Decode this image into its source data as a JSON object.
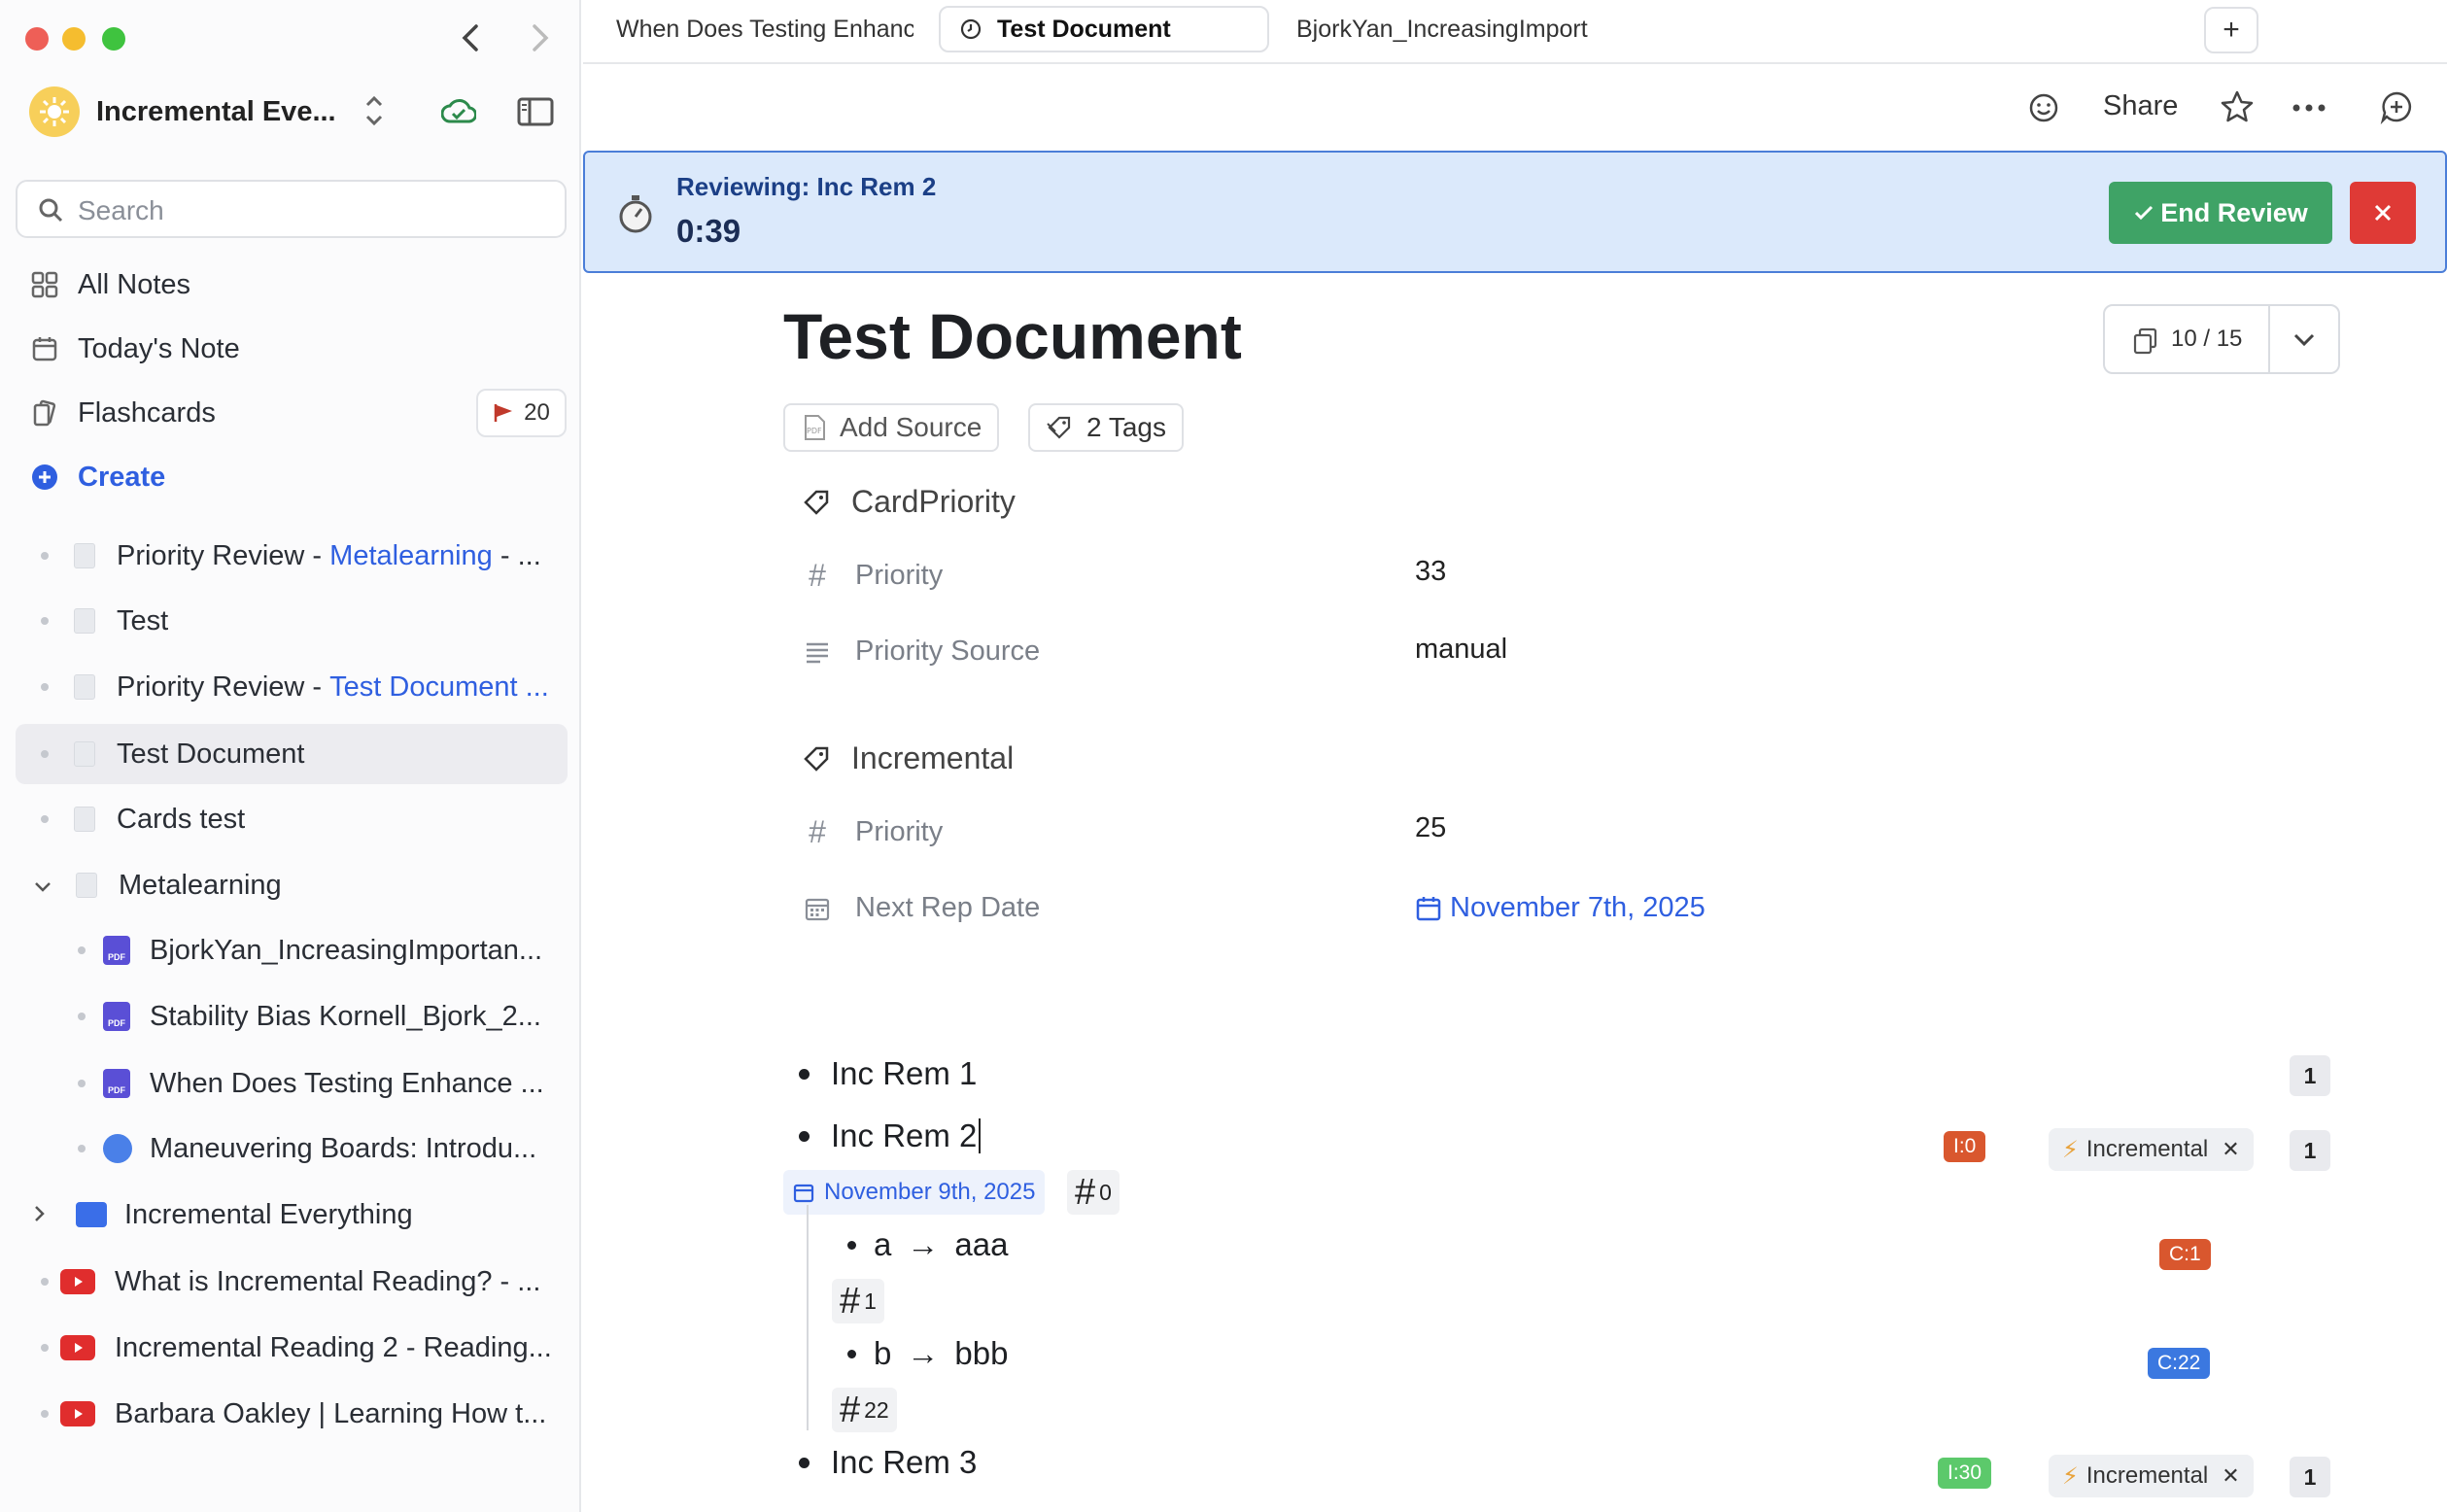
{
  "sidebar": {
    "workspace_name": "Incremental Eve...",
    "search_placeholder": "Search",
    "nav": {
      "all_notes": "All Notes",
      "todays_note": "Today's Note",
      "flashcards": "Flashcards",
      "flashcards_count": "20",
      "create": "Create"
    },
    "tree": {
      "r1_a": "Priority Review - ",
      "r1_b": "Metalearning",
      "r1_c": " - ...",
      "r2": "Test",
      "r3_a": "Priority Review - ",
      "r3_b": "Test Document ...",
      "r4": "Test Document",
      "r5": "Cards test",
      "r6": "Metalearning",
      "r7": "BjorkYan_IncreasingImportan...",
      "r8": "Stability Bias Kornell_Bjork_2...",
      "r9": "When Does Testing Enhance ...",
      "r10": "Maneuvering Boards: Introdu...",
      "r11": "Incremental Everything",
      "r12": "What is Incremental Reading? - ...",
      "r13": "Incremental Reading 2 - Reading...",
      "r14": "Barbara Oakley | Learning How t..."
    }
  },
  "tabs": {
    "t1": "When Does Testing Enhanc",
    "t2": "Test Document",
    "t3": "BjorkYan_IncreasingImport",
    "add": "+"
  },
  "toolbar": {
    "share": "Share"
  },
  "review": {
    "title": "Reviewing: Inc Rem 2",
    "timer": "0:39",
    "end_label": "End Review"
  },
  "document": {
    "title": "Test Document",
    "pager": "10 / 15",
    "add_source": "Add Source",
    "tags": "2 Tags",
    "card_priority": {
      "heading": "CardPriority",
      "priority_label": "Priority",
      "priority_value": "33",
      "source_label": "Priority Source",
      "source_value": "manual"
    },
    "incremental": {
      "heading": "Incremental",
      "priority_label": "Priority",
      "priority_value": "25",
      "next_label": "Next Rep Date",
      "next_value": "November 7th, 2025"
    }
  },
  "rems": {
    "r1": {
      "text": "Inc Rem 1",
      "count": "1"
    },
    "r2": {
      "text": "Inc Rem 2",
      "chip": "I:0",
      "tag": "Incremental",
      "count": "1",
      "date": "November 9th, 2025",
      "hash": "0"
    },
    "c1": {
      "front": "a",
      "arrow": "→",
      "back": "aaa",
      "chip": "C:1",
      "hash": "1"
    },
    "c2": {
      "front": "b",
      "arrow": "→",
      "back": "bbb",
      "chip": "C:22",
      "hash": "22"
    },
    "r3": {
      "text": "Inc Rem 3",
      "chip": "I:30",
      "tag": "Incremental",
      "count": "1"
    }
  },
  "colors": {
    "accent": "#2f5fe0",
    "end_review": "#3fa366",
    "close": "#df3a36",
    "chip_orange": "#d9572e",
    "chip_blue": "#3b78e0",
    "chip_green": "#5cc96b"
  }
}
